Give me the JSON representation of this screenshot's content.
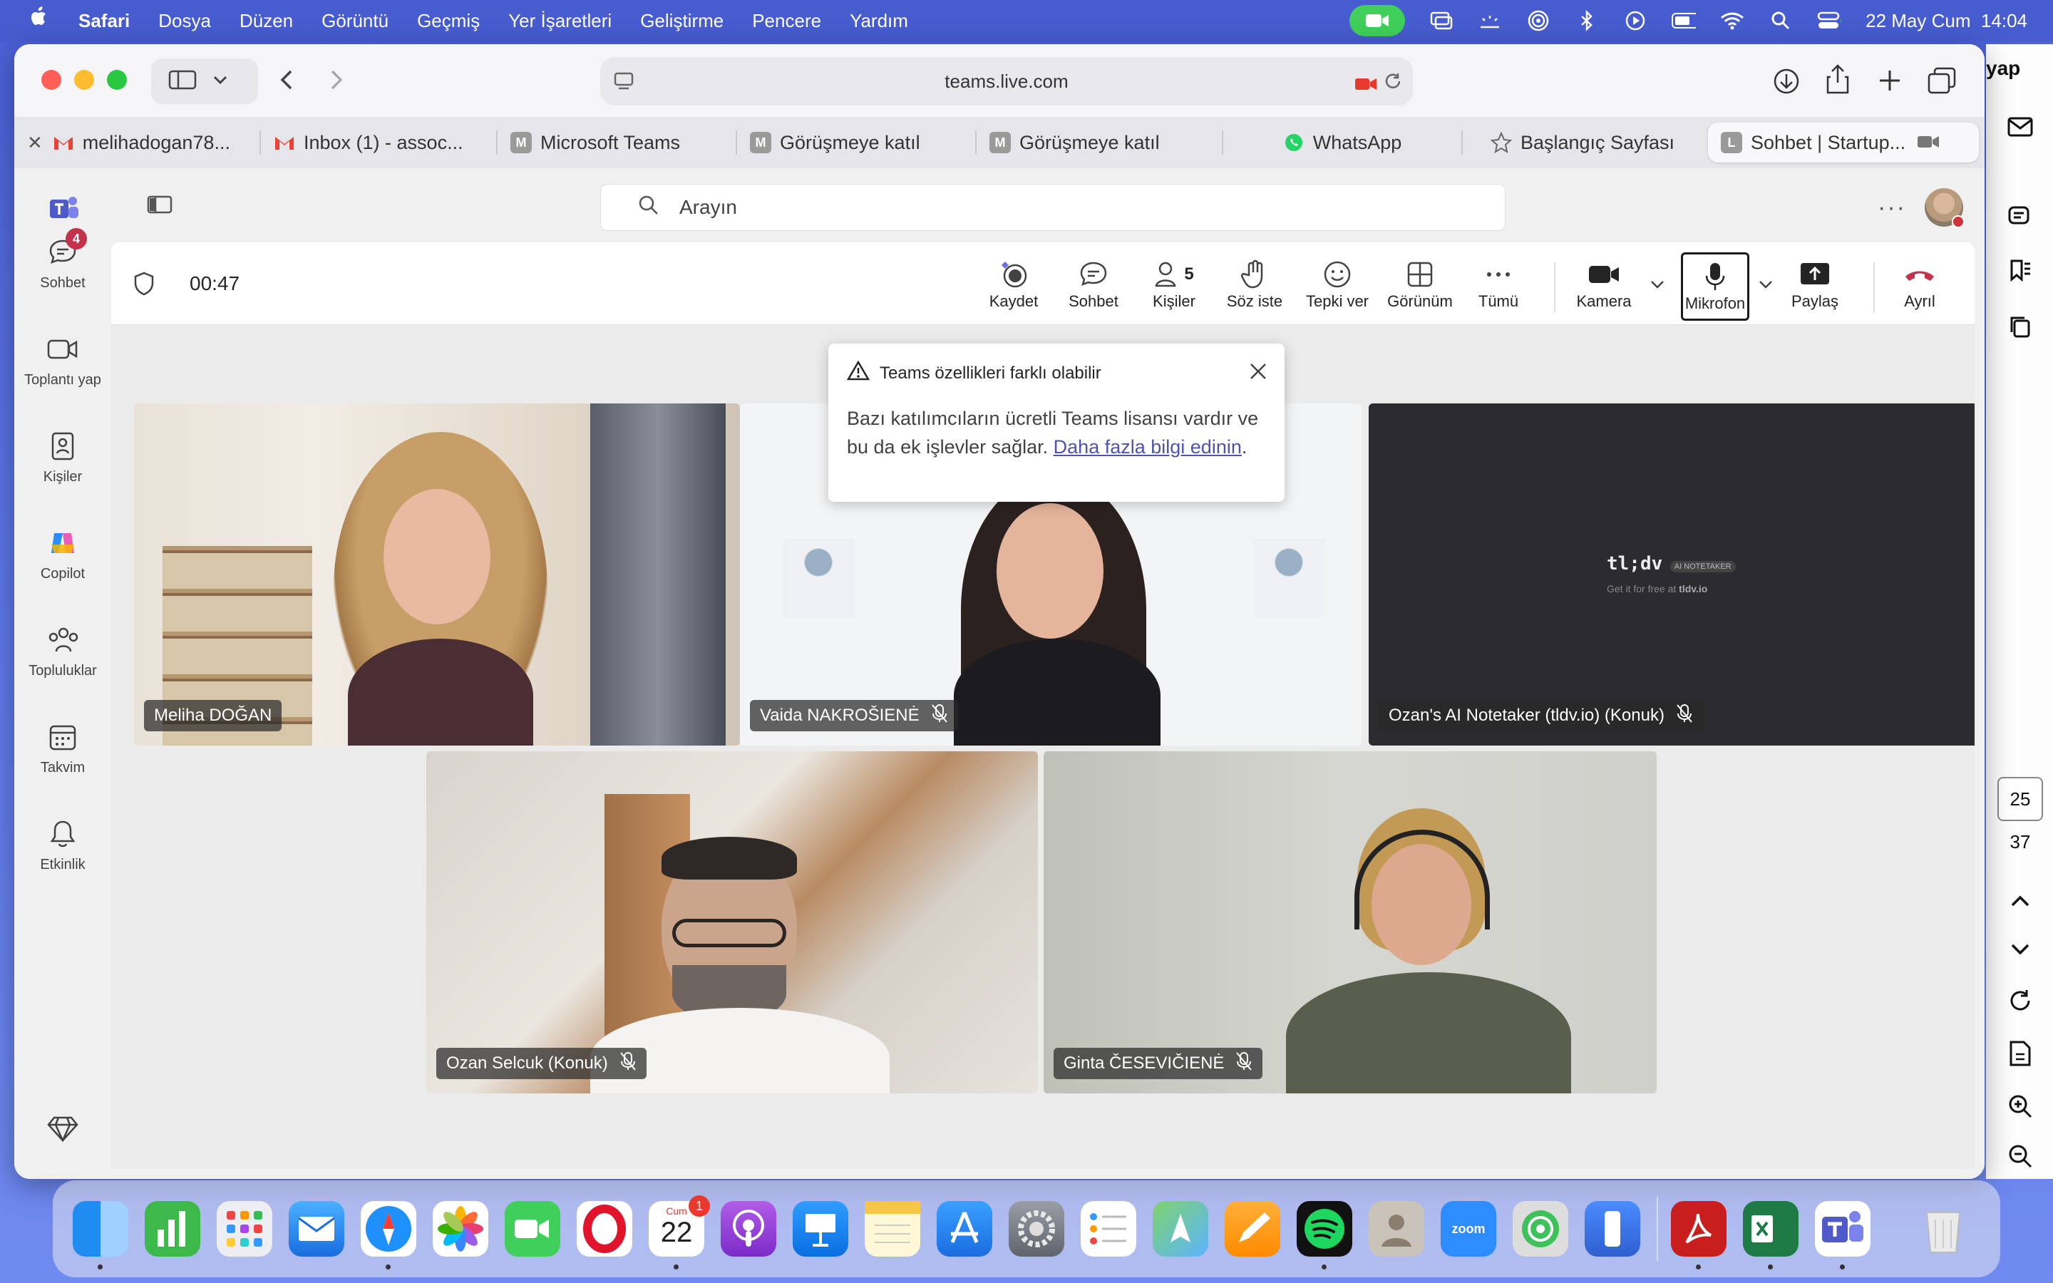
{
  "menubar": {
    "app_name": "Safari",
    "menus": [
      "Dosya",
      "Düzen",
      "Görüntü",
      "Geçmiş",
      "Yer İşaretleri",
      "Geliştirme",
      "Pencere",
      "Yardım"
    ],
    "datetime": "22 May Cum  14:04"
  },
  "browser": {
    "url": "teams.live.com",
    "tabs": [
      {
        "label": "melihadogan78...",
        "icon": "gmail-icon",
        "color": "#ea4335"
      },
      {
        "label": "Inbox (1) - assoc...",
        "icon": "gmail-icon",
        "color": "#ea4335"
      },
      {
        "label": "Microsoft Teams",
        "icon": "letter-m-icon",
        "letter": "M",
        "color": "#9a9a9a"
      },
      {
        "label": "Görüşmeye katıl",
        "icon": "letter-m-icon",
        "letter": "M",
        "color": "#9a9a9a"
      },
      {
        "label": "Görüşmeye katıl",
        "icon": "letter-m-icon",
        "letter": "M",
        "color": "#9a9a9a"
      },
      {
        "label": "WhatsApp",
        "icon": "whatsapp-icon",
        "color": "#25d366"
      },
      {
        "label": "Başlangıç Sayfası",
        "icon": "star-icon",
        "color": "#888"
      },
      {
        "label": "Sohbet | Startup...",
        "icon": "letter-l-icon",
        "letter": "L",
        "color": "#9a9a9a"
      }
    ],
    "partial_right_text": "yap"
  },
  "teams": {
    "search_placeholder": "Arayın",
    "rail": [
      {
        "label": "Sohbet",
        "badge": "4"
      },
      {
        "label": "Toplantı yap"
      },
      {
        "label": "Kişiler"
      },
      {
        "label": "Copilot"
      },
      {
        "label": "Topluluklar"
      },
      {
        "label": "Takvim"
      },
      {
        "label": "Etkinlik"
      }
    ],
    "meeting": {
      "timer": "00:47",
      "controls": {
        "record": "Kaydet",
        "chat": "Sohbet",
        "people": "Kişiler",
        "people_count": "5",
        "raise_hand": "Söz iste",
        "react": "Tepki ver",
        "view": "Görünüm",
        "more": "Tümü",
        "camera": "Kamera",
        "mic": "Mikrofon",
        "share": "Paylaş",
        "leave": "Ayrıl"
      },
      "popup": {
        "title": "Teams özellikleri farklı olabilir",
        "body": "Bazı katılımcıların ücretli Teams lisansı vardır ve bu da ek işlevler sağlar.",
        "link": "Daha fazla bilgi edinin",
        "end": "."
      },
      "participants": [
        {
          "name": "Meliha DOĞAN",
          "muted": false
        },
        {
          "name": "Vaida NAKROŠIENĖ",
          "muted": true
        },
        {
          "name": "Ozan's AI Notetaker (tldv.io) (Konuk)",
          "muted": true
        },
        {
          "name": "Ozan Selcuk (Konuk)",
          "muted": true
        },
        {
          "name": "Ginta ČESEVIČIENĖ",
          "muted": true
        }
      ],
      "tldv": {
        "logo": "tl;dv",
        "tag": "AI NOTETAKER",
        "sub": "Get it for free at",
        "sub_link": "tldv.io"
      }
    }
  },
  "right_panel": {
    "page_current": "25",
    "page_total": "37"
  },
  "dock": {
    "calendar_day": "22",
    "calendar_month": "Cum",
    "calendar_badge": "1",
    "zoom_label": "zoom"
  }
}
